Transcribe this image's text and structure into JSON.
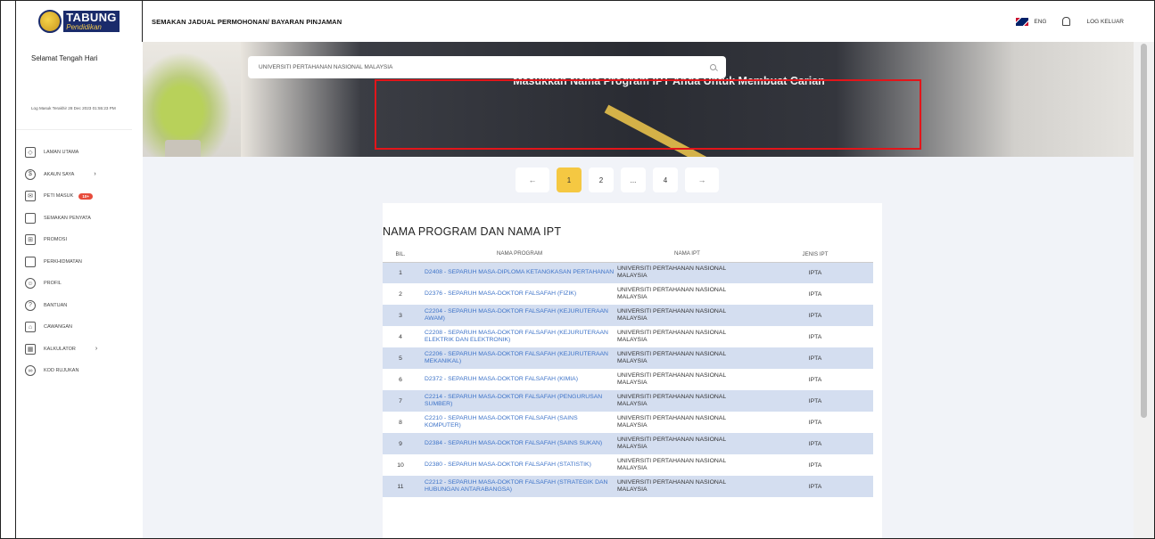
{
  "header": {
    "logo_top": "TABUNG",
    "logo_bottom": "Pendidikan",
    "title": "SEMAKAN JADUAL PERMOHONAN/ BAYARAN PINJAMAN",
    "lang": "ENG",
    "logout": "LOG KELUAR"
  },
  "sidebar": {
    "greeting": "Selamat Tengah Hari",
    "last_login": "Log Masuk Terakhir 28 Dec 2023 01:55:23 PM",
    "items": [
      {
        "label": "LAMAN UTAMA",
        "icon": "layers-icon"
      },
      {
        "label": "AKAUN SAYA",
        "icon": "dollar-icon",
        "arrow": "›"
      },
      {
        "label": "PETI MASUK",
        "icon": "mail-icon",
        "badge": "10+"
      },
      {
        "label": "SEMAKAN PENYATA",
        "icon": "document-icon"
      },
      {
        "label": "PROMOSI",
        "icon": "gift-icon"
      },
      {
        "label": "PERKHIDMATAN",
        "icon": "phone-icon"
      },
      {
        "label": "PROFIL",
        "icon": "user-icon"
      },
      {
        "label": "BANTUAN",
        "icon": "help-icon"
      },
      {
        "label": "CAWANGAN",
        "icon": "branch-icon"
      },
      {
        "label": "KALKULATOR",
        "icon": "calculator-icon",
        "arrow": "›"
      },
      {
        "label": "KOD RUJUKAN",
        "icon": "link-icon"
      }
    ]
  },
  "hero": {
    "heading": "Masukkan Nama Program IPT Anda Untuk Membuat Carian",
    "search_value": "UNIVERSITI PERTAHANAN NASIONAL MALAYSIA"
  },
  "pagination": {
    "prev": "←",
    "pages": [
      "1",
      "2",
      "...",
      "4"
    ],
    "next": "→"
  },
  "table": {
    "title": "NAMA PROGRAM DAN NAMA IPT",
    "headers": {
      "bil": "BIL.",
      "program": "NAMA PROGRAM",
      "ipt": "NAMA IPT",
      "jenis": "JENIS IPT"
    },
    "rows": [
      {
        "bil": "1",
        "program": "D2408 - SEPARUH MASA-DIPLOMA KETANGKASAN PERTAHANAN",
        "ipt": "UNIVERSITI PERTAHANAN NASIONAL MALAYSIA",
        "jenis": "IPTA"
      },
      {
        "bil": "2",
        "program": "D2376 - SEPARUH MASA-DOKTOR FALSAFAH (FIZIK)",
        "ipt": "UNIVERSITI PERTAHANAN NASIONAL MALAYSIA",
        "jenis": "IPTA"
      },
      {
        "bil": "3",
        "program": "C2204 - SEPARUH MASA-DOKTOR FALSAFAH (KEJURUTERAAN AWAM)",
        "ipt": "UNIVERSITI PERTAHANAN NASIONAL MALAYSIA",
        "jenis": "IPTA"
      },
      {
        "bil": "4",
        "program": "C2208 - SEPARUH MASA-DOKTOR FALSAFAH (KEJURUTERAAN ELEKTRIK DAN ELEKTRONIK)",
        "ipt": "UNIVERSITI PERTAHANAN NASIONAL MALAYSIA",
        "jenis": "IPTA"
      },
      {
        "bil": "5",
        "program": "C2206 - SEPARUH MASA-DOKTOR FALSAFAH (KEJURUTERAAN MEKANIKAL)",
        "ipt": "UNIVERSITI PERTAHANAN NASIONAL MALAYSIA",
        "jenis": "IPTA"
      },
      {
        "bil": "6",
        "program": "D2372 - SEPARUH MASA-DOKTOR FALSAFAH (KIMIA)",
        "ipt": "UNIVERSITI PERTAHANAN NASIONAL MALAYSIA",
        "jenis": "IPTA"
      },
      {
        "bil": "7",
        "program": "C2214 - SEPARUH MASA-DOKTOR FALSAFAH (PENGURUSAN SUMBER)",
        "ipt": "UNIVERSITI PERTAHANAN NASIONAL MALAYSIA",
        "jenis": "IPTA"
      },
      {
        "bil": "8",
        "program": "C2210 - SEPARUH MASA-DOKTOR FALSAFAH (SAINS KOMPUTER)",
        "ipt": "UNIVERSITI PERTAHANAN NASIONAL MALAYSIA",
        "jenis": "IPTA"
      },
      {
        "bil": "9",
        "program": "D2384 - SEPARUH MASA-DOKTOR FALSAFAH (SAINS SUKAN)",
        "ipt": "UNIVERSITI PERTAHANAN NASIONAL MALAYSIA",
        "jenis": "IPTA"
      },
      {
        "bil": "10",
        "program": "D2380 - SEPARUH MASA-DOKTOR FALSAFAH (STATISTIK)",
        "ipt": "UNIVERSITI PERTAHANAN NASIONAL MALAYSIA",
        "jenis": "IPTA"
      },
      {
        "bil": "11",
        "program": "C2212 - SEPARUH MASA-DOKTOR FALSAFAH (STRATEGIK DAN HUBUNGAN ANTARABANGSA)",
        "ipt": "UNIVERSITI PERTAHANAN NASIONAL MALAYSIA",
        "jenis": "IPTA"
      }
    ]
  }
}
